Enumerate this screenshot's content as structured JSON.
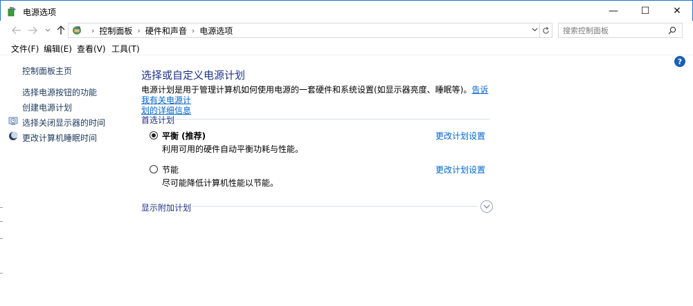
{
  "window": {
    "title": "电源选项",
    "minimize_glyph": "—",
    "maximize_glyph": "☐",
    "close_glyph": "✕"
  },
  "address": {
    "breadcrumbs": [
      "控制面板",
      "硬件和声音",
      "电源选项"
    ],
    "search_placeholder": "搜索控制面板"
  },
  "menu": {
    "items": [
      "文件(F)",
      "编辑(E)",
      "查看(V)",
      "工具(T)"
    ]
  },
  "left_panel": {
    "home": "控制面板主页",
    "links": [
      "选择电源按钮的功能",
      "创建电源计划",
      "选择关闭显示器的时间",
      "更改计算机睡眠时间"
    ]
  },
  "main": {
    "title": "选择或自定义电源计划",
    "description": "电源计划是用于管理计算机如何使用电源的一套硬件和系统设置(如显示器亮度、睡眠等)。",
    "description_link_line1": "告诉我有关电源计",
    "description_link_line2": "划的详细信息",
    "preferred_header": "首选计划",
    "plans": [
      {
        "name": "平衡 (推荐)",
        "desc": "利用可用的硬件自动平衡功耗与性能。",
        "link": "更改计划设置",
        "selected": true
      },
      {
        "name": "节能",
        "desc": "尽可能降低计算机性能以节能。",
        "link": "更改计划设置",
        "selected": false
      }
    ],
    "additional_header": "显示附加计划"
  },
  "colors": {
    "title_blue": "#1e3287",
    "link_blue": "#0066cc",
    "left_link": "#1e395b",
    "window_border": "#1a73c8"
  }
}
